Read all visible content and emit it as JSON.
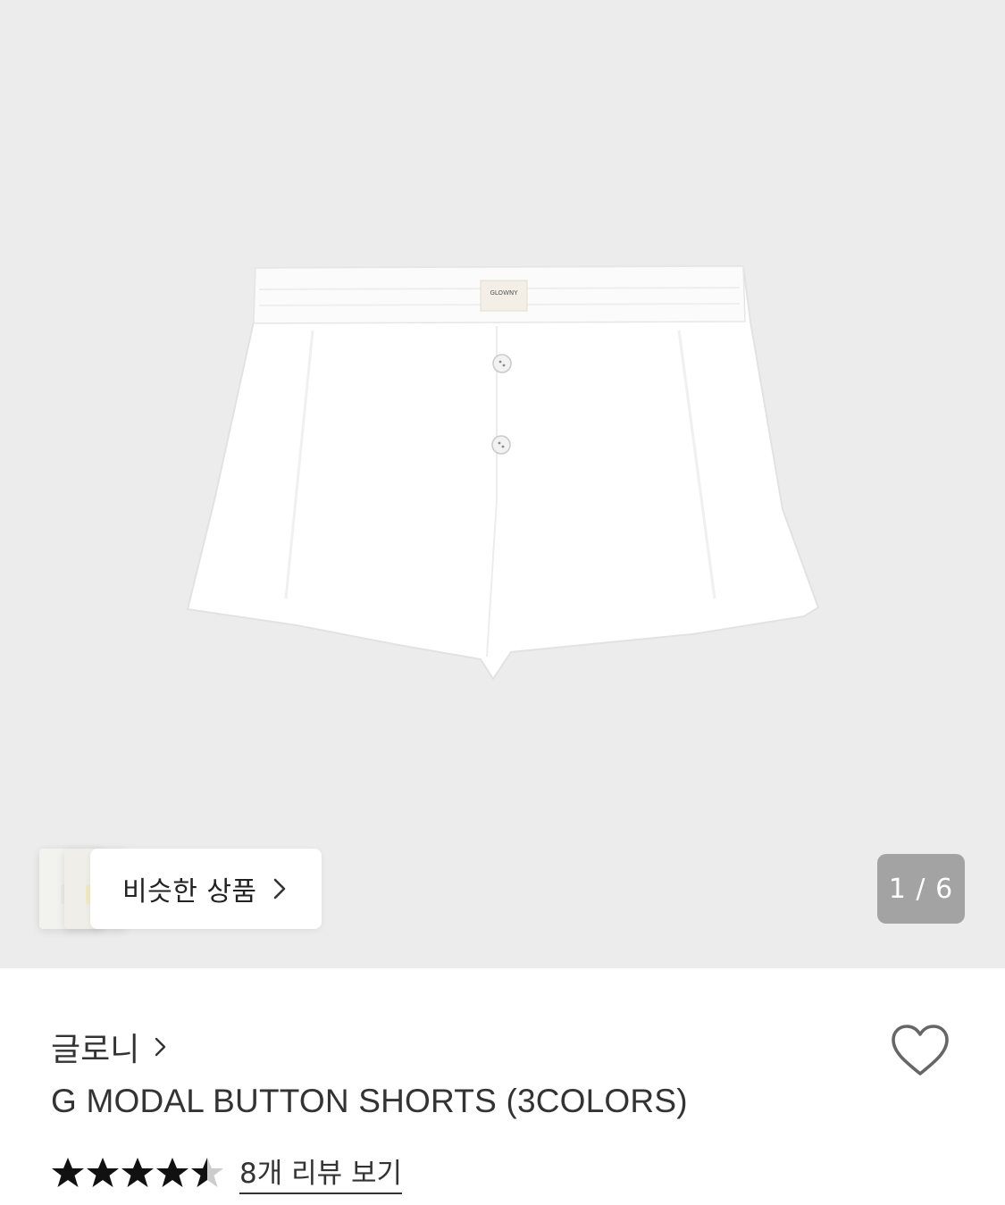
{
  "gallery": {
    "image_alt": "white modal button shorts",
    "label_brand": "GLOWNY",
    "counter": "1 / 6",
    "similar_button_label": "비슷한 상품",
    "background": "#ececec"
  },
  "product": {
    "brand": "글로니",
    "title": "G MODAL BUTTON SHORTS (3COLORS)",
    "rating": 4.5,
    "rating_max": 5,
    "review_link": "8개 리뷰 보기",
    "favorited": false
  }
}
